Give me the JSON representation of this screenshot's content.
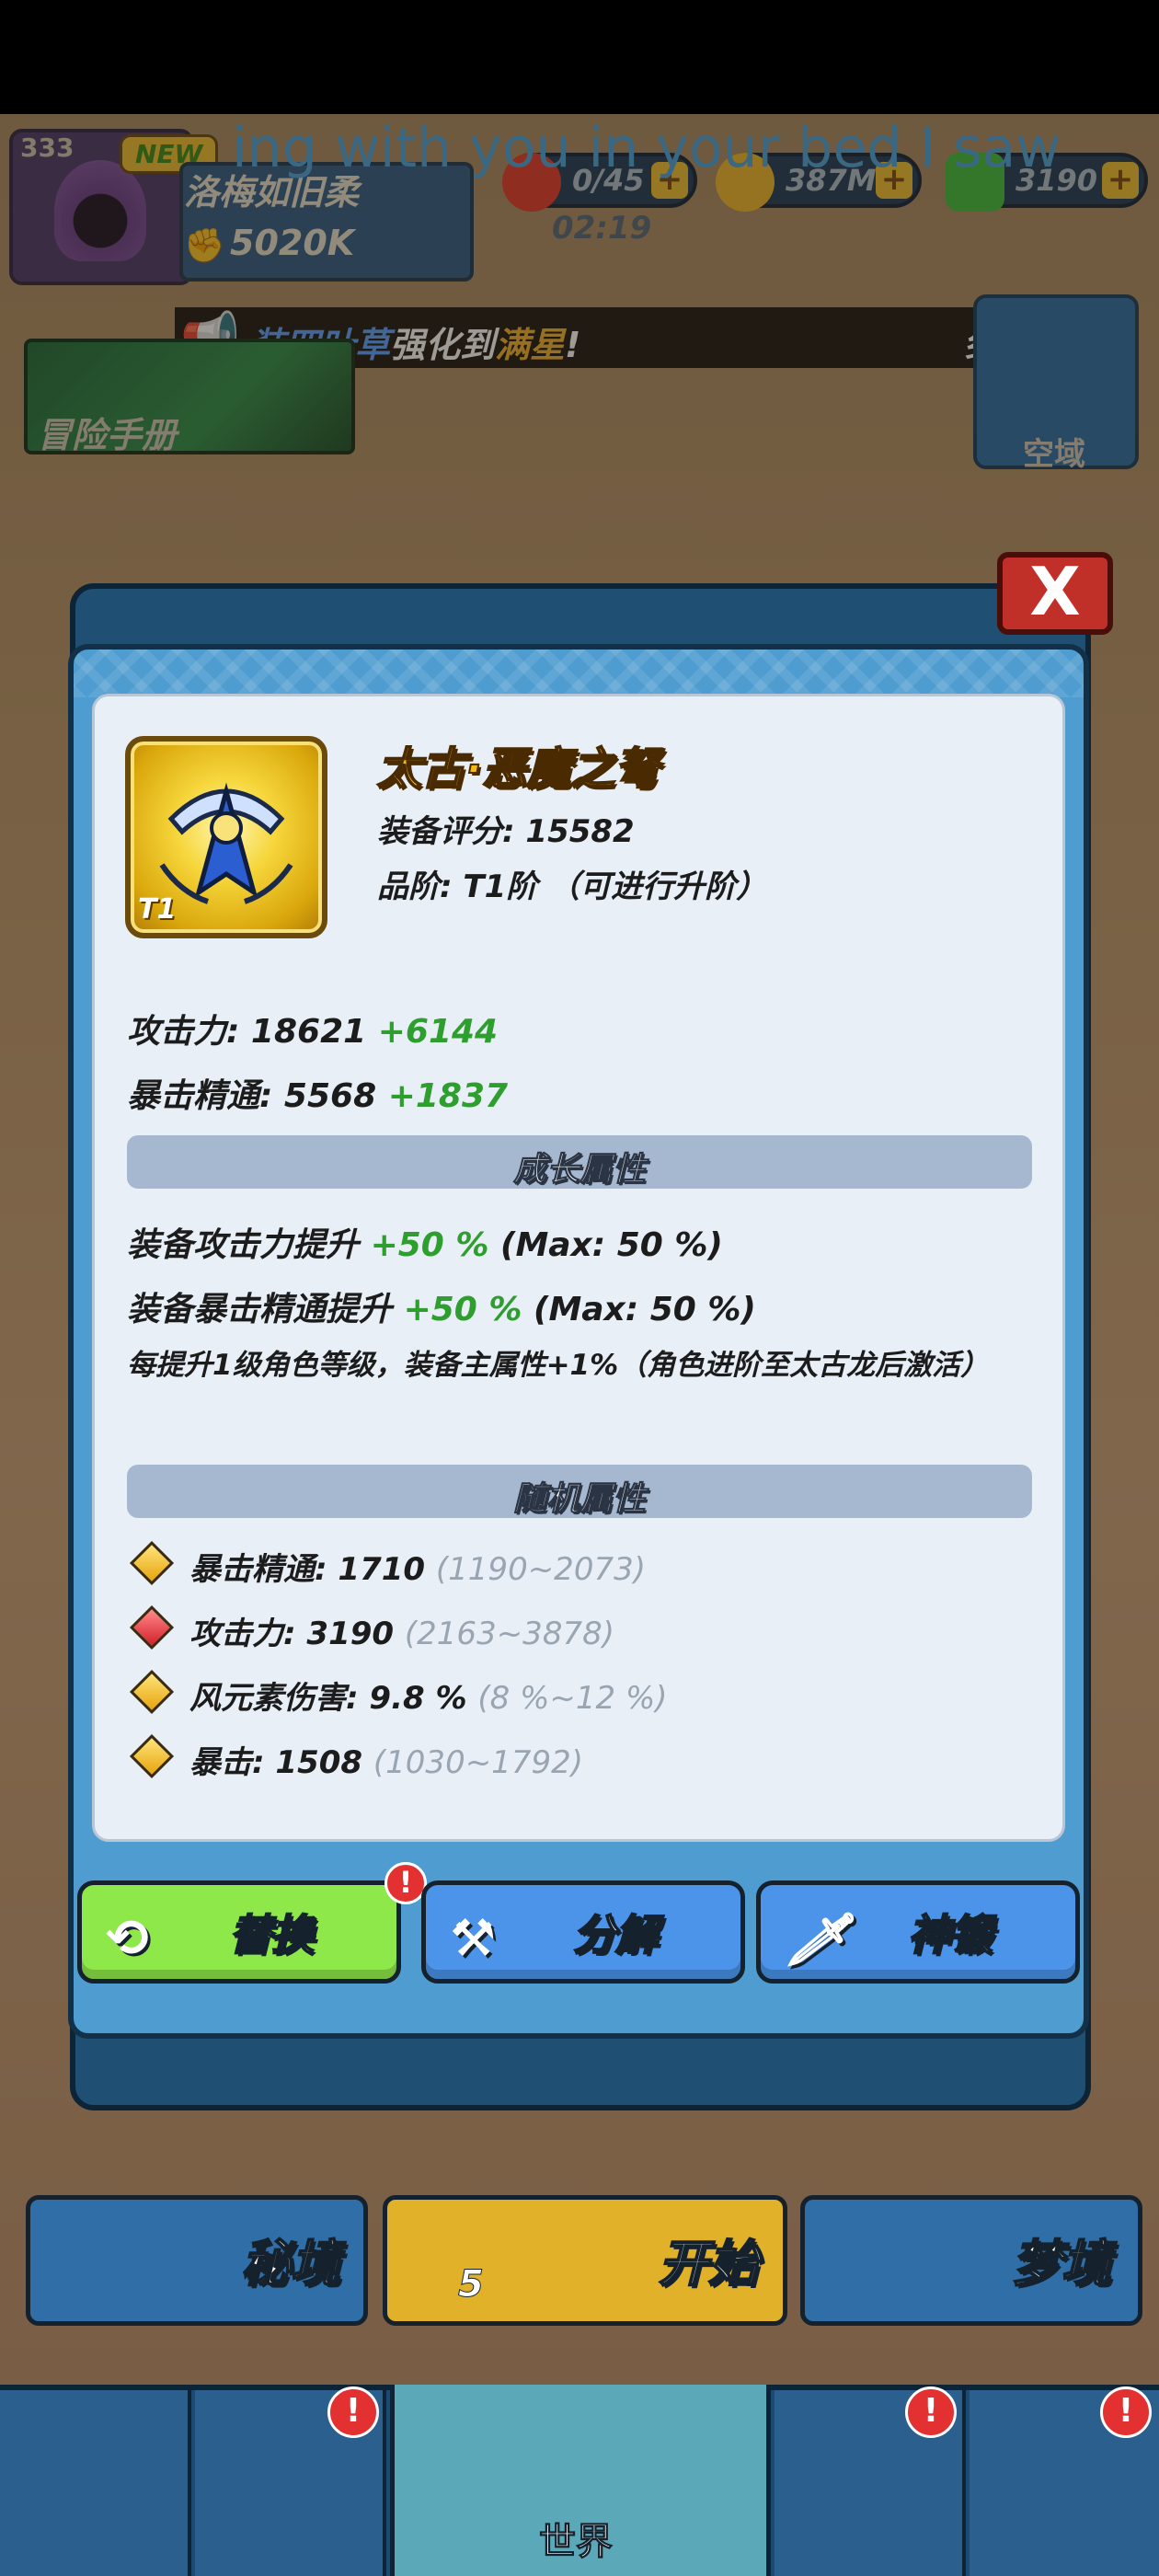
{
  "topbar": {
    "level": "333",
    "new_badge": "NEW",
    "player_name": "洛梅如旧柔",
    "power": "5020K",
    "energy_count": "0/45",
    "timer": "02:19",
    "gold": "387M",
    "gems": "3190",
    "plus": "+"
  },
  "overlay_lyric": "ing with you in your bed I saw",
  "marquee": {
    "part1": "装四叶草",
    "part2": "强化到",
    "part3": "满星",
    "part4": "!",
    "tail": "乡"
  },
  "side": {
    "manual_label": "冒险手册",
    "sky_label": "空域"
  },
  "dialog": {
    "close_label": "X",
    "item": {
      "name": "太古·恶魔之弩",
      "tier_badge": "T1",
      "score": "装备评分: 15582",
      "rank": "品阶: T1阶 （可进行升阶）"
    },
    "base_stats": [
      {
        "label": "攻击力: 18621",
        "bonus": "+6144"
      },
      {
        "label": "暴击精通: 5568",
        "bonus": "+1837"
      }
    ],
    "growth": {
      "title": "成长属性",
      "lines": [
        {
          "label": "装备攻击力提升",
          "value": "+50 %",
          "max": "(Max: 50 %)"
        },
        {
          "label": "装备暴击精通提升",
          "value": "+50 %",
          "max": "(Max: 50 %)"
        }
      ],
      "note": "每提升1级角色等级，装备主属性+1%（角色进阶至太古龙后激活）"
    },
    "random": {
      "title": "随机属性",
      "lines": [
        {
          "label": "暴击精通: 1710",
          "range": "(1190~2073)",
          "color": "gold"
        },
        {
          "label": "攻击力: 3190",
          "range": "(2163~3878)",
          "color": "red"
        },
        {
          "label": "风元素伤害: 9.8 %",
          "range": "(8 %~12 %)",
          "color": "gold"
        },
        {
          "label": "暴击: 1508",
          "range": "(1030~1792)",
          "color": "gold"
        }
      ]
    },
    "buttons": {
      "replace": "替换",
      "decompose": "分解",
      "forge": "神锻",
      "alert": "!"
    }
  },
  "modes": {
    "secret": "秘境",
    "start": "开始",
    "start_energy": "5",
    "dream": "梦境"
  },
  "nav": {
    "world": "世界",
    "alert": "!"
  },
  "colors": {
    "gold_name": "#f6b816",
    "bonus_green": "#2e9e2e",
    "replace_green": "#8ee84a",
    "action_blue": "#4b94ea",
    "section_bar": "#a6b8cf"
  }
}
